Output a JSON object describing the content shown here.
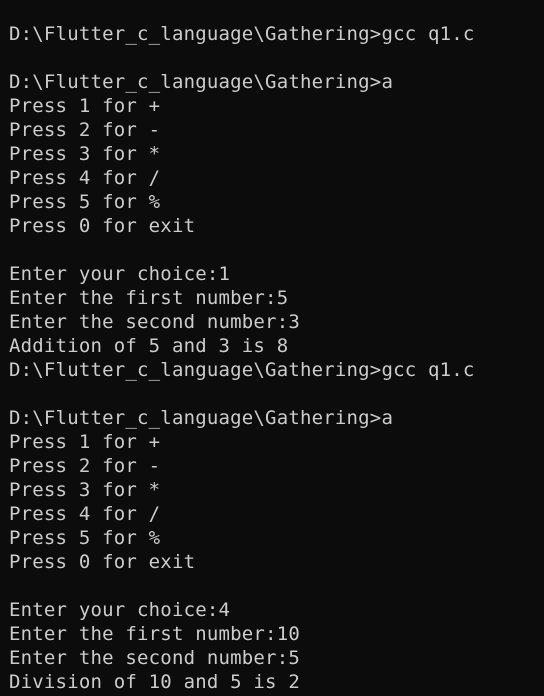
{
  "terminal": {
    "lines": [
      "D:\\Flutter_c_language\\Gathering>gcc q1.c",
      "",
      "D:\\Flutter_c_language\\Gathering>a",
      "Press 1 for +",
      "Press 2 for -",
      "Press 3 for *",
      "Press 4 for /",
      "Press 5 for %",
      "Press 0 for exit",
      "",
      "Enter your choice:1",
      "Enter the first number:5",
      "Enter the second number:3",
      "Addition of 5 and 3 is 8",
      "D:\\Flutter_c_language\\Gathering>gcc q1.c",
      "",
      "D:\\Flutter_c_language\\Gathering>a",
      "Press 1 for +",
      "Press 2 for -",
      "Press 3 for *",
      "Press 4 for /",
      "Press 5 for %",
      "Press 0 for exit",
      "",
      "Enter your choice:4",
      "Enter the first number:10",
      "Enter the second number:5",
      "Division of 10 and 5 is 2"
    ],
    "colors": {
      "background": "#0c0c0c",
      "text": "#cccccc"
    }
  }
}
